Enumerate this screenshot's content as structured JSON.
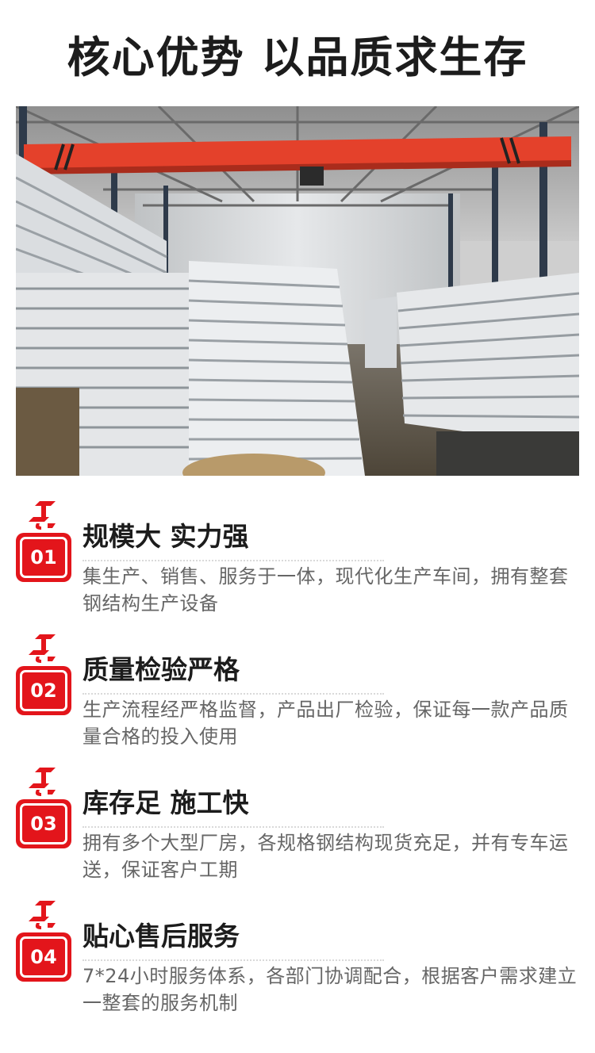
{
  "title": "核心优势 以品质求生存",
  "photo": {
    "subject": "factory-warehouse-photo"
  },
  "colors": {
    "accent": "#e3151b",
    "title": "#1c1c1c",
    "text": "#666666"
  },
  "items": [
    {
      "number": "01",
      "title": "规模大 实力强",
      "desc": "集生产、销售、服务于一体，现代化生产车间，拥有整套钢结构生产设备"
    },
    {
      "number": "02",
      "title": "质量检验严格",
      "desc": "生产流程经严格监督，产品出厂检验，保证每一款产品质量合格的投入使用"
    },
    {
      "number": "03",
      "title": "库存足 施工快",
      "desc": "拥有多个大型厂房，各规格钢结构现货充足，并有专车运送，保证客户工期"
    },
    {
      "number": "04",
      "title": "贴心售后服务",
      "desc": "7*24小时服务体系，各部门协调配合，根据客户需求建立一整套的服务机制"
    }
  ]
}
